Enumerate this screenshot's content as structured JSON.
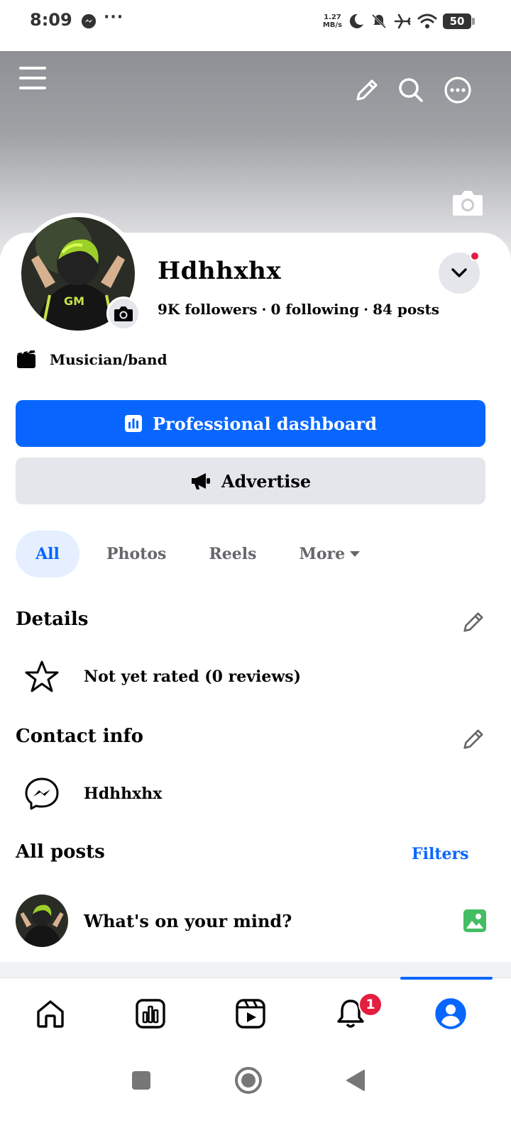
{
  "status_bar": {
    "time": "8:09",
    "dots": "···",
    "net_speed_value": "1.27",
    "net_speed_unit": "MB/s",
    "battery": "50"
  },
  "profile": {
    "name": "Hdhhxhx",
    "followers": "9K followers",
    "following": "0 following",
    "posts": "84 posts",
    "separator": "·",
    "category": "Musician/band"
  },
  "actions": {
    "primary_label": "Professional dashboard",
    "secondary_label": "Advertise"
  },
  "tabs": [
    {
      "label": "All",
      "active": true
    },
    {
      "label": "Photos",
      "active": false
    },
    {
      "label": "Reels",
      "active": false
    },
    {
      "label": "More",
      "active": false
    }
  ],
  "details": {
    "heading": "Details",
    "rating_text": "Not yet rated (0 reviews)"
  },
  "contact": {
    "heading": "Contact info",
    "messenger_name": "Hdhhxhx"
  },
  "posts_section": {
    "heading": "All posts",
    "filters_label": "Filters",
    "composer_placeholder": "What's on your mind?"
  },
  "bottom_nav": {
    "items": [
      {
        "icon": "home-icon"
      },
      {
        "icon": "dashboard-icon"
      },
      {
        "icon": "reels-icon"
      },
      {
        "icon": "bell-icon",
        "badge": "1"
      },
      {
        "icon": "profile-icon",
        "active": true
      }
    ]
  },
  "colors": {
    "accent": "#0866ff",
    "secondary_bg": "#e4e6eb",
    "badge": "#e41e3f",
    "photo_green": "#45bd62"
  }
}
